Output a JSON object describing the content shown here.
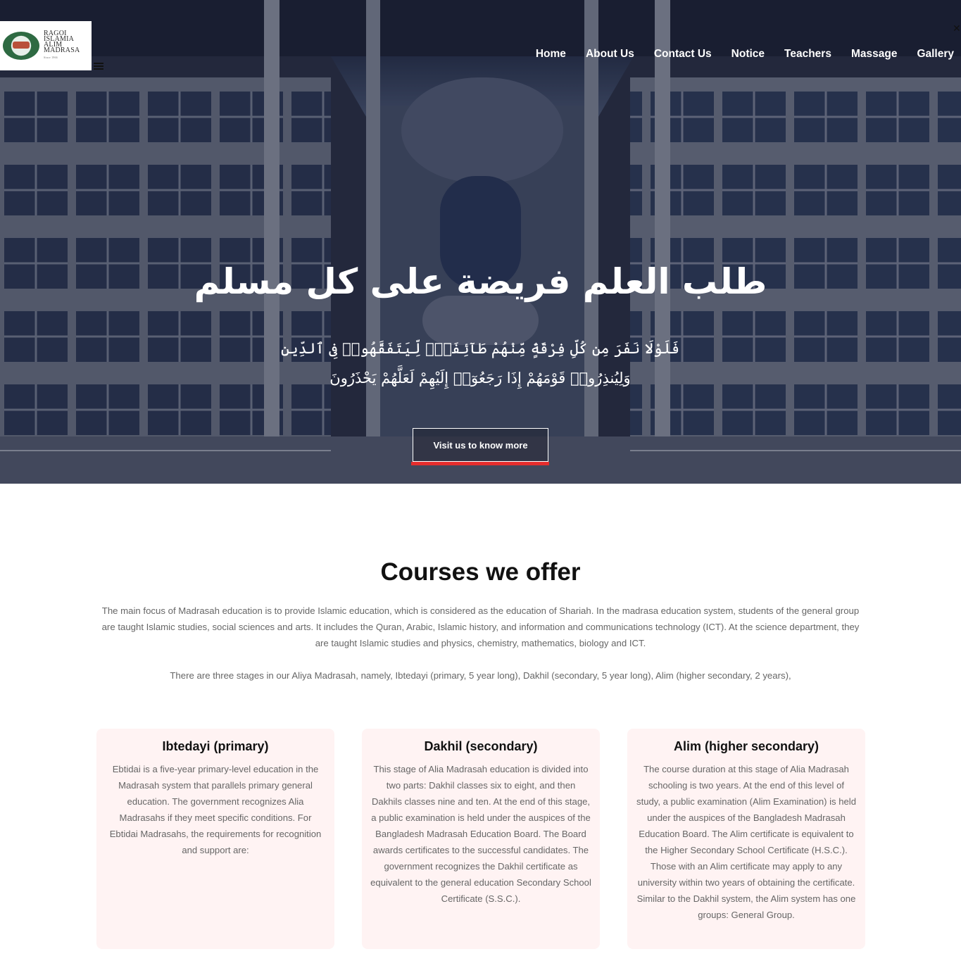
{
  "logo": {
    "line1": "RAGOI",
    "line2": "ISLAMIA",
    "line3": "ALIM",
    "line4": "MADRASA",
    "since": "Since 1966"
  },
  "nav": {
    "items": [
      {
        "label": "Home"
      },
      {
        "label": "About Us"
      },
      {
        "label": "Contact Us"
      },
      {
        "label": "Notice"
      },
      {
        "label": "Teachers"
      },
      {
        "label": "Massage"
      },
      {
        "label": "Gallery"
      }
    ]
  },
  "hero": {
    "title": "طلب العلم فريضة على كل مسلم",
    "verse_line1": "فَلَوْلَا نَفَرَ مِن كُلِّ فِرْقَةٍۢ مِّنْهُمْ طَآئِفَةٌۭ لِّيَتَفَقَّهُوا۟ فِى ٱلدِّينِ",
    "verse_line2": "وَلِيُنذِرُوا۟ قَوْمَهُمْ إِذَا رَجَعُوٓا۟ إِلَيْهِمْ لَعَلَّهُمْ يَحْذَرُونَ",
    "button_label": "Visit us to know more",
    "accent_color": "#e52d2d"
  },
  "courses": {
    "title": "Courses we offer",
    "intro": "The main focus of Madrasah education is to provide Islamic education, which is considered as the education of Shariah. In the madrasa education system, students of the general group are taught Islamic studies, social sciences and arts. It includes the Quran, Arabic, Islamic history, and information and communications technology (ICT). At the science department, they are taught Islamic studies and physics, chemistry, mathematics, biology and ICT.",
    "stages": "There are three stages in our Aliya Madrasah, namely, Ibtedayi (primary, 5 year long), Dakhil (secondary, 5 year long), Alim (higher secondary, 2 years),",
    "cards": [
      {
        "title": "Ibtedayi (primary)",
        "body": "Ebtidai is a five-year primary-level education in the Madrasah system that parallels primary general education. The government recognizes Alia Madrasahs if they meet specific conditions. For Ebtidai Madrasahs, the requirements for recognition and support are:"
      },
      {
        "title": "Dakhil (secondary)",
        "body": "This stage of Alia Madrasah education is divided into two parts: Dakhil classes six to eight, and then Dakhils classes nine and ten. At the end of this stage, a public examination is held under the auspices of the Bangladesh Madrasah Education Board. The Board awards certificates to the successful candidates. The government recognizes the Dakhil certificate as equivalent to the general education Secondary School Certificate (S.S.C.)."
      },
      {
        "title": "Alim (higher secondary)",
        "body": "The course duration at this stage of Alia Madrasah schooling is two years. At the end of this level of study, a public examination (Alim Examination) is held under the auspices of the Bangladesh Madrasah Education Board. The Alim certificate is equivalent to the Higher Secondary School Certificate (H.S.C.). Those with an Alim certificate may apply to any university within two years of obtaining the certificate. Similar to the Dakhil system, the Alim system has one groups: General Group."
      }
    ],
    "card_background": "#fff3f3"
  }
}
